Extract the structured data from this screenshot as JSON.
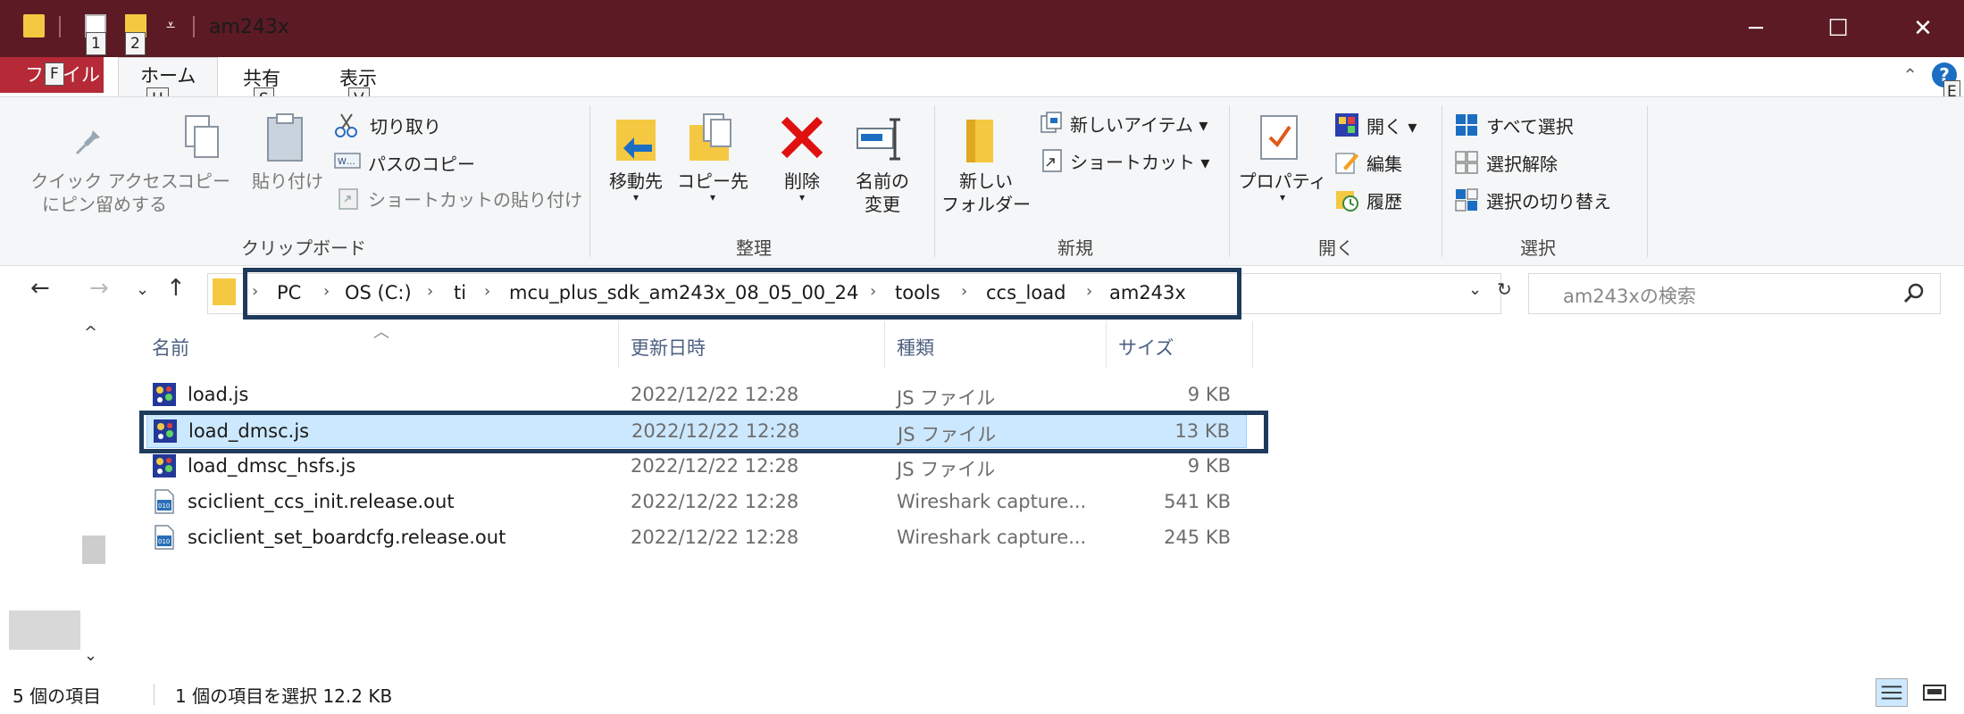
{
  "window": {
    "title": "am243x",
    "qat_keytips": [
      "1",
      "2"
    ],
    "minimize": "─",
    "maximize": "☐",
    "close": "✕"
  },
  "tabs": {
    "file": "ファイル",
    "file_keytip": "F",
    "home": "ホーム",
    "home_keytip": "H",
    "share": "共有",
    "share_keytip": "S",
    "view": "表示",
    "view_keytip": "V",
    "help_keytip": "E"
  },
  "ribbon": {
    "clipboard": {
      "label": "クリップボード",
      "pin_line1": "クイック アクセス",
      "pin_line2": "にピン留めする",
      "copy": "コピー",
      "paste": "貼り付け",
      "cut": "切り取り",
      "copy_path": "パスのコピー",
      "paste_shortcut": "ショートカットの貼り付け"
    },
    "organize": {
      "label": "整理",
      "move_to": "移動先",
      "copy_to": "コピー先",
      "delete": "削除",
      "rename_line1": "名前の",
      "rename_line2": "変更"
    },
    "new": {
      "label": "新規",
      "new_folder_line1": "新しい",
      "new_folder_line2": "フォルダー",
      "new_item": "新しいアイテム",
      "shortcut": "ショートカット"
    },
    "open": {
      "label": "開く",
      "properties": "プロパティ",
      "open": "開く",
      "edit": "編集",
      "history": "履歴"
    },
    "select": {
      "label": "選択",
      "select_all": "すべて選択",
      "select_none": "選択解除",
      "invert": "選択の切り替え"
    }
  },
  "address": {
    "crumbs": [
      "PC",
      "OS (C:)",
      "ti",
      "mcu_plus_sdk_am243x_08_05_00_24",
      "tools",
      "ccs_load",
      "am243x"
    ],
    "search_placeholder": "am243xの検索"
  },
  "columns": {
    "name": "名前",
    "date": "更新日時",
    "type": "種類",
    "size": "サイズ"
  },
  "files": [
    {
      "name": "load.js",
      "date": "2022/12/22 12:28",
      "type": "JS ファイル",
      "size": "9 KB",
      "icon": "js-file-icon"
    },
    {
      "name": "load_dmsc.js",
      "date": "2022/12/22 12:28",
      "type": "JS ファイル",
      "size": "13 KB",
      "icon": "js-file-icon",
      "selected": true
    },
    {
      "name": "load_dmsc_hsfs.js",
      "date": "2022/12/22 12:28",
      "type": "JS ファイル",
      "size": "9 KB",
      "icon": "js-file-icon"
    },
    {
      "name": "sciclient_ccs_init.release.out",
      "date": "2022/12/22 12:28",
      "type": "Wireshark capture...",
      "size": "541 KB",
      "icon": "binary-file-icon"
    },
    {
      "name": "sciclient_set_boardcfg.release.out",
      "date": "2022/12/22 12:28",
      "type": "Wireshark capture...",
      "size": "245 KB",
      "icon": "binary-file-icon"
    }
  ],
  "status": {
    "count": "5 個の項目",
    "selection": "1 個の項目を選択  12.2 KB"
  },
  "colors": {
    "titlebar": "#5c1a24",
    "file_tab": "#b52a36",
    "highlight_box": "#1f3b5c",
    "selection": "#cce8ff"
  }
}
